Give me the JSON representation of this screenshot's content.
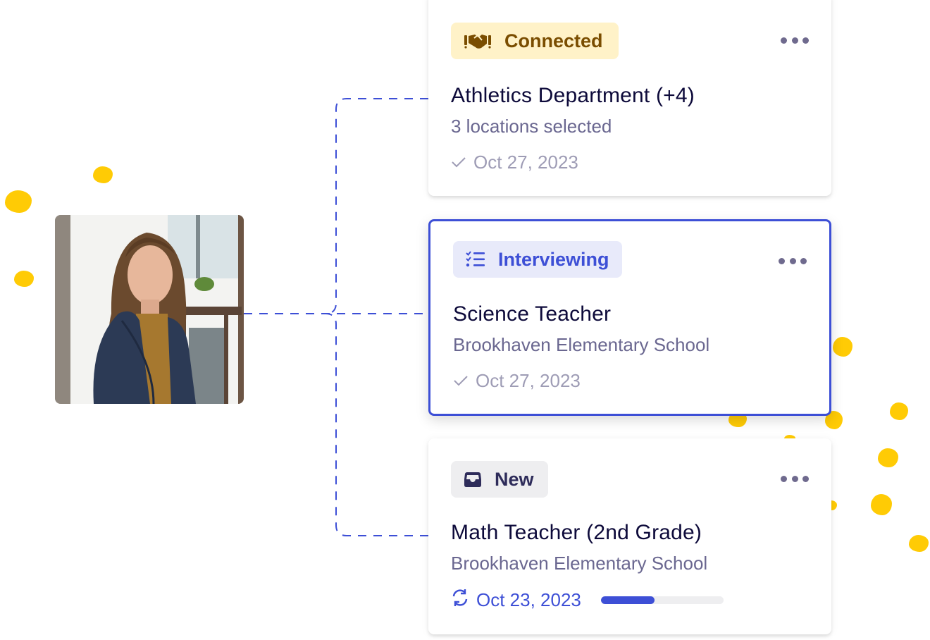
{
  "colors": {
    "accent": "#3D4FD6",
    "dot_yellow": "#FFCB05",
    "connected_bg": "#FFF2C8",
    "connected_fg": "#7A4D00",
    "interviewing_bg": "#E8EAFA",
    "new_bg": "#EEEEF0",
    "new_fg": "#2E2C5A"
  },
  "candidate": {
    "photo_alt": "Candidate photo: smiling woman with long brown hair in a navy blazer",
    "photo_icon": "person-photo"
  },
  "cards": [
    {
      "status": {
        "label": "Connected",
        "icon": "handshake-icon"
      },
      "title": "Athletics Department (+4)",
      "subtitle": "3 locations selected",
      "date": {
        "icon": "check-icon",
        "text": "Oct 27, 2023"
      },
      "selected": false,
      "menu_icon": "more-horizontal-icon"
    },
    {
      "status": {
        "label": "Interviewing",
        "icon": "checklist-icon"
      },
      "title": "Science Teacher",
      "subtitle": "Brookhaven Elementary School",
      "date": {
        "icon": "check-icon",
        "text": "Oct 27, 2023"
      },
      "selected": true,
      "menu_icon": "more-horizontal-icon"
    },
    {
      "status": {
        "label": "New",
        "icon": "inbox-icon"
      },
      "title": "Math Teacher (2nd Grade)",
      "subtitle": "Brookhaven Elementary School",
      "date": {
        "icon": "sync-icon",
        "text": "Oct 23, 2023"
      },
      "progress_percent": 44,
      "selected": false,
      "menu_icon": "more-horizontal-icon"
    }
  ]
}
